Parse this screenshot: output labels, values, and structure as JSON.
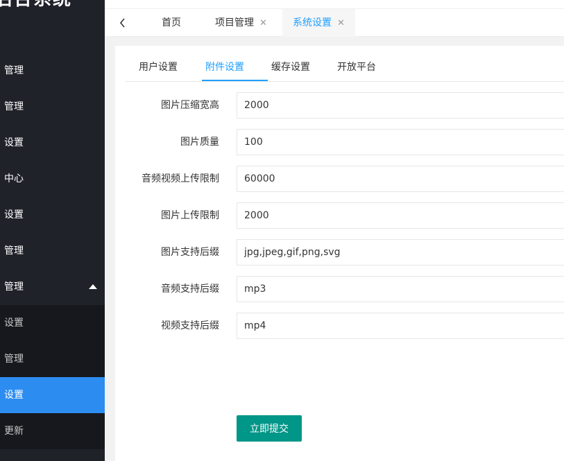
{
  "sidebar": {
    "logo_text": "后台系统",
    "items": [
      {
        "label": "管理"
      },
      {
        "label": "管理"
      },
      {
        "label": "设置"
      },
      {
        "label": "中心"
      },
      {
        "label": "设置"
      },
      {
        "label": "管理"
      },
      {
        "label": "管理",
        "expanded": true
      }
    ],
    "subitems": [
      {
        "label": "设置"
      },
      {
        "label": "管理"
      },
      {
        "label": "设置",
        "active": true
      },
      {
        "label": "更新"
      }
    ]
  },
  "tabs": {
    "items": [
      {
        "label": "首页",
        "closable": false
      },
      {
        "label": "项目管理",
        "closable": true,
        "close_glyph": "✕"
      },
      {
        "label": "系统设置",
        "closable": true,
        "active": true,
        "close_glyph": "✕"
      }
    ]
  },
  "settings_tabs": [
    {
      "label": "用户设置"
    },
    {
      "label": "附件设置",
      "active": true
    },
    {
      "label": "缓存设置"
    },
    {
      "label": "开放平台"
    }
  ],
  "form": {
    "fields": [
      {
        "label": "图片压缩宽高",
        "value": "2000"
      },
      {
        "label": "图片质量",
        "value": "100"
      },
      {
        "label": "音频视频上传限制",
        "value": "60000"
      },
      {
        "label": "图片上传限制",
        "value": "2000"
      },
      {
        "label": "图片支持后缀",
        "value": "jpg,jpeg,gif,png,svg"
      },
      {
        "label": "音频支持后缀",
        "value": "mp3"
      },
      {
        "label": "视频支持后缀",
        "value": "mp4"
      }
    ],
    "submit_label": "立即提交"
  },
  "colors": {
    "sidebar_bg": "#20222a",
    "active_blue": "#2d8cf0",
    "tab_active": "#1e9fff",
    "submit_bg": "#009688"
  }
}
